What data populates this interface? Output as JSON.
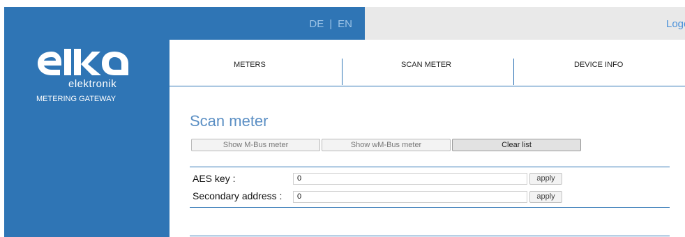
{
  "lang": {
    "de": "DE",
    "separator": "|",
    "en": "EN"
  },
  "header": {
    "logout": "Logout"
  },
  "brand": {
    "logo_text": "elka",
    "subtitle": "elektronik",
    "tagline": "METERING GATEWAY"
  },
  "nav": {
    "meters": "METERS",
    "scan_meter": "SCAN METER",
    "device_info": "DEVICE INFO"
  },
  "main": {
    "title": "Scan meter",
    "buttons": {
      "show_mbus": "Show M-Bus meter",
      "show_wmbus": "Show wM-Bus meter",
      "clear_list": "Clear list"
    },
    "aes": {
      "label": "AES key :",
      "value": "0",
      "apply": "apply"
    },
    "secondary": {
      "label": "Secondary address :",
      "value": "0",
      "apply": "apply"
    }
  },
  "colors": {
    "brand_blue": "#2f75b5",
    "header_grey": "#e9e9e9",
    "title_blue": "#5b8fc4"
  }
}
